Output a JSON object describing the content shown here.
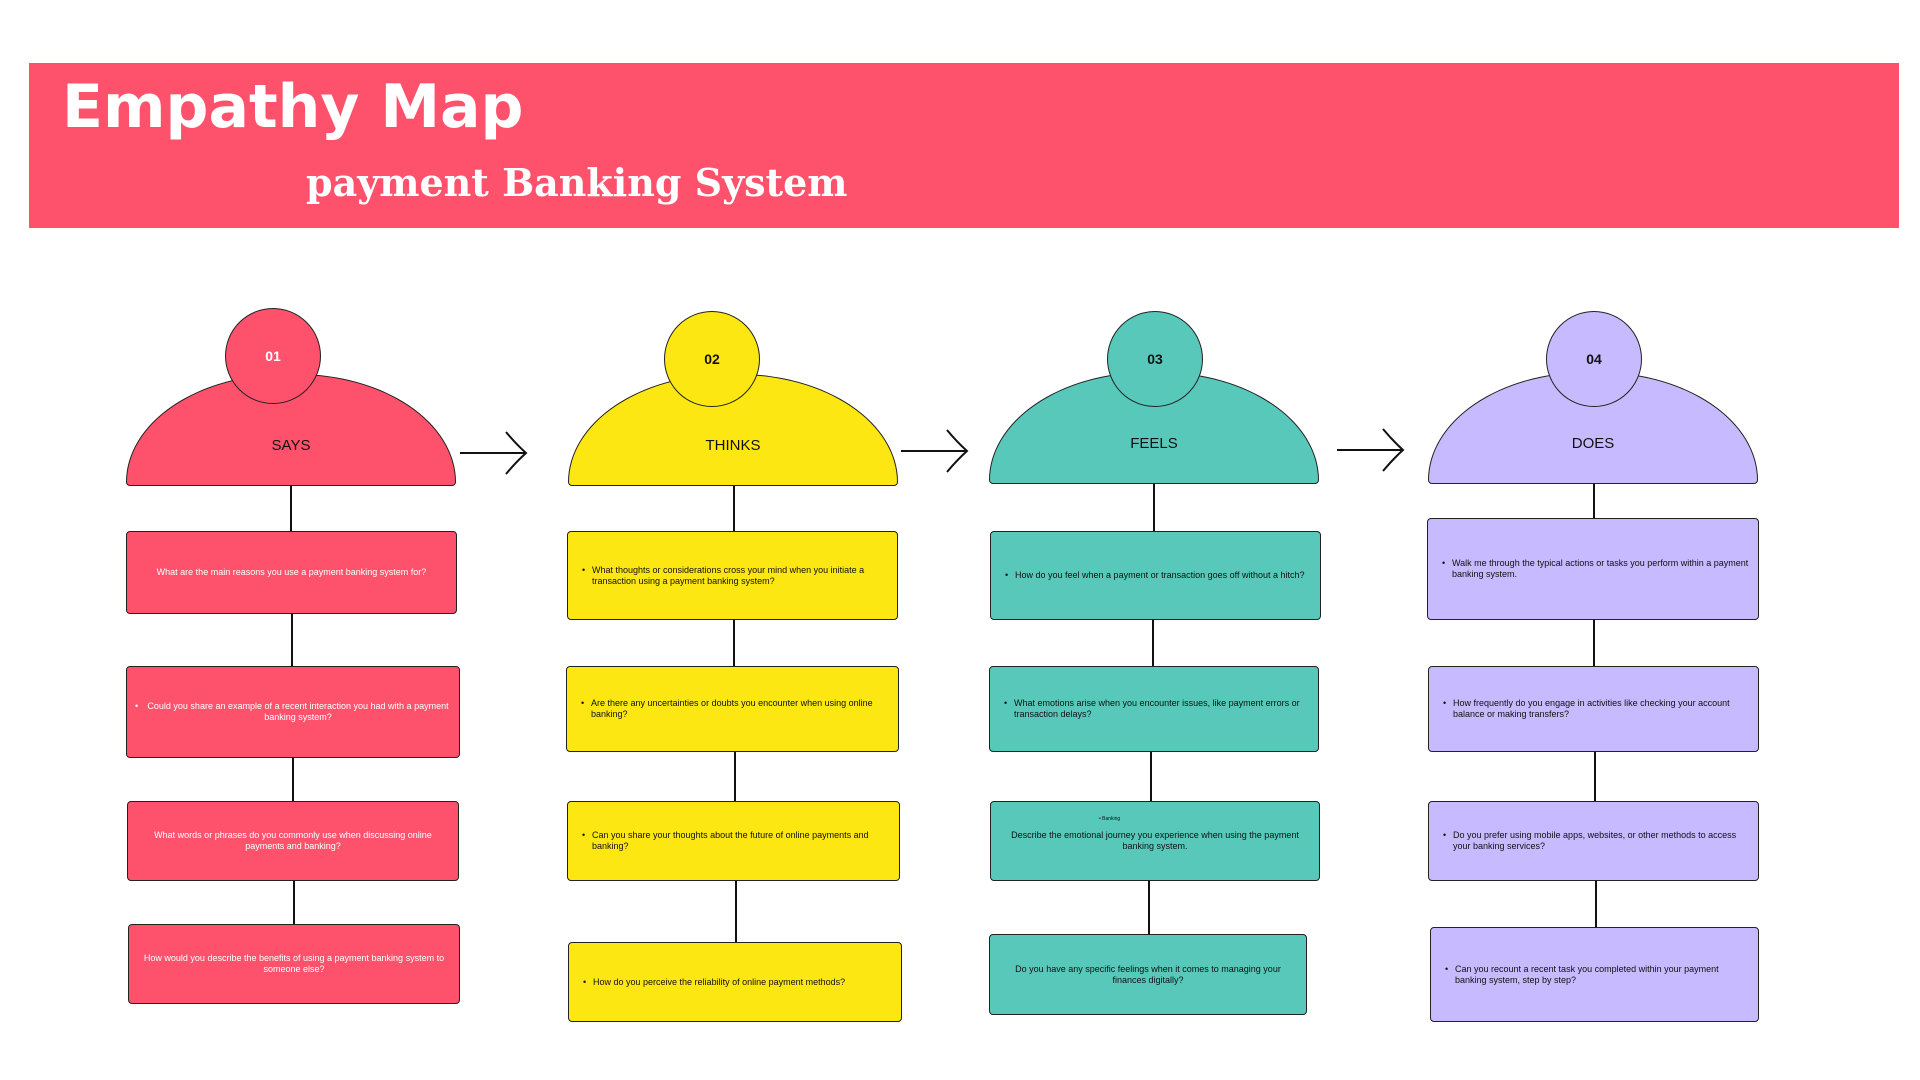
{
  "header": {
    "title": "Empathy Map",
    "subtitle": "payment Banking  System"
  },
  "colors": {
    "banner": "#fe526c",
    "says": "#fe526c",
    "thinks": "#fde712",
    "feels": "#58c8bb",
    "does": "#c8bafe"
  },
  "columns": [
    {
      "number": "01",
      "label": "SAYS",
      "cards": [
        "What are the main reasons you use a payment banking system for?",
        "Could you share an example of a recent interaction you had with a payment banking system?",
        "What words or phrases do you commonly use when discussing online payments and banking?",
        "How would you describe the benefits of using a payment banking system to someone else?"
      ]
    },
    {
      "number": "02",
      "label": "THINKS",
      "cards": [
        "What thoughts or considerations cross your mind when you initiate a transaction using a payment banking system?",
        "Are there any uncertainties or doubts you encounter when using online banking?",
        "Can you share your thoughts about the future of online payments and banking?",
        "How do you perceive the reliability of online payment methods?"
      ]
    },
    {
      "number": "03",
      "label": "FEELS",
      "cards": [
        "How do you feel when a payment or transaction goes off without a hitch?",
        "What emotions arise when you encounter issues, like payment errors or transaction delays?",
        "Describe the emotional journey you experience when using the payment banking system.",
        "Do you have any specific feelings when it comes to managing your finances digitally?"
      ],
      "note": "• Banking"
    },
    {
      "number": "04",
      "label": "DOES",
      "cards": [
        "Walk me through the typical actions or tasks you perform within a payment banking system.",
        "How frequently do you engage in activities like checking your account balance or making transfers?",
        "Do you prefer using mobile apps, websites, or other methods to access your banking services?",
        "Can you recount a recent task you completed within your payment banking system, step by step?"
      ]
    }
  ]
}
